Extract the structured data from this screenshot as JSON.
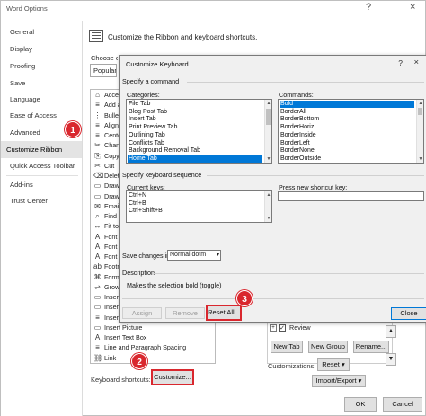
{
  "window": {
    "title": "Word Options",
    "help": "?",
    "close": "×"
  },
  "nav": {
    "items": [
      "General",
      "Display",
      "Proofing",
      "Save",
      "Language",
      "Ease of Access",
      "Advanced",
      "Customize Ribbon",
      "Quick Access Toolbar",
      "Add-ins",
      "Trust Center"
    ],
    "active": "Customize Ribbon"
  },
  "main": {
    "header": "Customize the Ribbon and keyboard shortcuts.",
    "choose_label": "Choose c",
    "choose_value": "Popular",
    "commands": [
      {
        "icon": "⌂",
        "text": "Acces"
      },
      {
        "icon": "≡",
        "text": "Add a"
      },
      {
        "icon": "⋮",
        "text": "Bullet"
      },
      {
        "icon": "≡",
        "text": "Align"
      },
      {
        "icon": "≡",
        "text": "Center"
      },
      {
        "icon": "✂",
        "text": "Chan"
      },
      {
        "icon": "⎘",
        "text": "Copy"
      },
      {
        "icon": "✂",
        "text": "Cut"
      },
      {
        "icon": "⌫",
        "text": "Delet"
      },
      {
        "icon": "▭",
        "text": "Draw"
      },
      {
        "icon": "▭",
        "text": "Draw"
      },
      {
        "icon": "✉",
        "text": "Email"
      },
      {
        "icon": "⌕",
        "text": "Find"
      },
      {
        "icon": "↔",
        "text": "Fit to"
      },
      {
        "icon": "A",
        "text": "Font"
      },
      {
        "icon": "A",
        "text": "Font"
      },
      {
        "icon": "A",
        "text": "Font"
      },
      {
        "icon": "ab",
        "text": "Footn"
      },
      {
        "icon": "⌘",
        "text": "Form"
      },
      {
        "icon": "⇌",
        "text": "Grow"
      },
      {
        "icon": "▭",
        "text": "Insert"
      },
      {
        "icon": "▭",
        "text": "Insert"
      },
      {
        "icon": "≡",
        "text": "Insert"
      },
      {
        "icon": "▭",
        "text": "Insert Picture"
      },
      {
        "icon": "A",
        "text": "Insert Text Box"
      },
      {
        "icon": "≡",
        "text": "Line and Paragraph Spacing"
      },
      {
        "icon": "⛓",
        "text": "Link"
      }
    ],
    "keyboard_label": "Keyboard shortcuts:",
    "customize_btn": "Customize...",
    "review_label": "Review",
    "new_tab_btn": "New Tab",
    "new_group_btn": "New Group",
    "rename_btn": "Rename...",
    "customizations_label": "Customizations:",
    "reset_btn": "Reset ▾",
    "import_export_btn": "Import/Export ▾",
    "ok_btn": "OK",
    "cancel_btn": "Cancel"
  },
  "dialog": {
    "title": "Customize Keyboard",
    "help": "?",
    "close": "×",
    "specify_command": "Specify a command",
    "categories_label": "Categories:",
    "categories": [
      "File Tab",
      "Blog Post Tab",
      "Insert Tab",
      "Print Preview Tab",
      "Outlining Tab",
      "Conflicts Tab",
      "Background Removal Tab",
      "Home Tab"
    ],
    "categories_selected": "Home Tab",
    "commands_label": "Commands:",
    "commands": [
      "Bold",
      "BorderAll",
      "BorderBottom",
      "BorderHoriz",
      "BorderInside",
      "BorderLeft",
      "BorderNone",
      "BorderOutside"
    ],
    "commands_selected": "Bold",
    "specify_sequence": "Specify keyboard sequence",
    "current_keys_label": "Current keys:",
    "current_keys": [
      "Ctrl+N",
      "Ctrl+B",
      "Ctrl+Shift+B"
    ],
    "press_new_label": "Press new shortcut key:",
    "save_changes_label": "Save changes in:",
    "save_changes_value": "Normal.dotm",
    "description_label": "Description",
    "description_text": "Makes the selection bold (toggle)",
    "assign_btn": "Assign",
    "remove_btn": "Remove",
    "reset_all_btn": "Reset All...",
    "close_btn": "Close"
  },
  "callouts": [
    "1",
    "2",
    "3"
  ],
  "colors": {
    "callout": "#d9272e",
    "selection": "#0078d7"
  }
}
